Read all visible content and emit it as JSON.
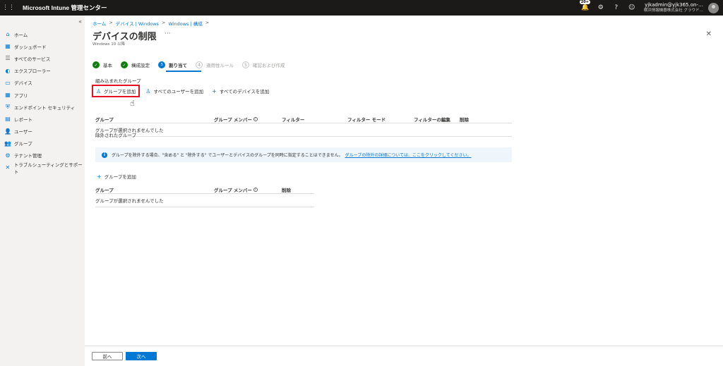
{
  "topbar": {
    "waffle": "⋮⋮",
    "title": "Microsoft Intune 管理センター",
    "badge": "20+",
    "account_email": "yjkadmin@yjk365.on-…",
    "account_org": "横浜情報機器株式会社 グラウド…"
  },
  "sidebar": {
    "collapse": "«",
    "items": [
      {
        "label": "ホーム",
        "icon": "home-icon",
        "glyph": "⌂",
        "color": "#0078d4"
      },
      {
        "label": "ダッシュボード",
        "icon": "dashboard-icon",
        "glyph": "▦",
        "color": "#0078d4"
      },
      {
        "label": "すべてのサービス",
        "icon": "all-services-icon",
        "glyph": "☰",
        "color": "#605e5c"
      },
      {
        "label": "エクスプローラー",
        "icon": "explorer-icon",
        "glyph": "◐",
        "color": "#0078d4"
      },
      {
        "label": "デバイス",
        "icon": "devices-icon",
        "glyph": "▭",
        "color": "#0078d4"
      },
      {
        "label": "アプリ",
        "icon": "apps-icon",
        "glyph": "▦",
        "color": "#0078d4"
      },
      {
        "label": "エンドポイント セキュリティ",
        "icon": "endpoint-security-icon",
        "glyph": "⛨",
        "color": "#0078d4"
      },
      {
        "label": "レポート",
        "icon": "reports-icon",
        "glyph": "▤",
        "color": "#0078d4"
      },
      {
        "label": "ユーザー",
        "icon": "users-icon",
        "glyph": "👤",
        "color": "#0078d4"
      },
      {
        "label": "グループ",
        "icon": "groups-icon",
        "glyph": "👥",
        "color": "#0078d4"
      },
      {
        "label": "テナント管理",
        "icon": "tenant-admin-icon",
        "glyph": "⚙",
        "color": "#0078d4"
      },
      {
        "label": "トラブルシューティングとサポート",
        "icon": "troubleshooting-icon",
        "glyph": "✕",
        "color": "#0078d4"
      }
    ]
  },
  "breadcrumb": [
    "ホーム",
    "デバイス | Windows",
    "Windows | 構成"
  ],
  "breadcrumb_sep": ">",
  "page": {
    "title": "デバイスの制限",
    "more": "···",
    "subtitle": "Windows 10 以降",
    "close": "✕"
  },
  "steps": [
    {
      "label": "基本",
      "state": "done",
      "mark": "✓"
    },
    {
      "label": "構成設定",
      "state": "done",
      "mark": "✓"
    },
    {
      "label": "割り当て",
      "state": "current",
      "mark": "3"
    },
    {
      "label": "適用性ルール",
      "state": "future",
      "mark": "4"
    },
    {
      "label": "確認および作成",
      "state": "future",
      "mark": "5"
    }
  ],
  "included": {
    "label": "組み込まれたグループ",
    "add_group": "グループを追加",
    "add_all_users": "すべてのユーザーを追加",
    "add_all_devices": "すべてのデバイスを追加",
    "headers": [
      "グループ",
      "グループ メンバー",
      "フィルター",
      "フィルター モード",
      "フィルターの編集",
      "削除"
    ],
    "empty": "グループが選択されませんでした"
  },
  "excluded": {
    "label": "除外されたグループ",
    "info_text": "グループを除外する場合、\"含める\" と \"除外する\" でユーザーとデバイスのグループを同時に指定することはできません。",
    "info_link": "グループの除外の詳細については、ここをクリックしてください。",
    "add_group": "グループを追加",
    "headers": [
      "グループ",
      "グループ メンバー",
      "削除"
    ],
    "empty": "グループが選択されませんでした"
  },
  "footer": {
    "prev": "前へ",
    "next": "次へ"
  },
  "colors": {
    "accent": "#0078d4",
    "success": "#107c10",
    "highlight": "#e81123"
  }
}
